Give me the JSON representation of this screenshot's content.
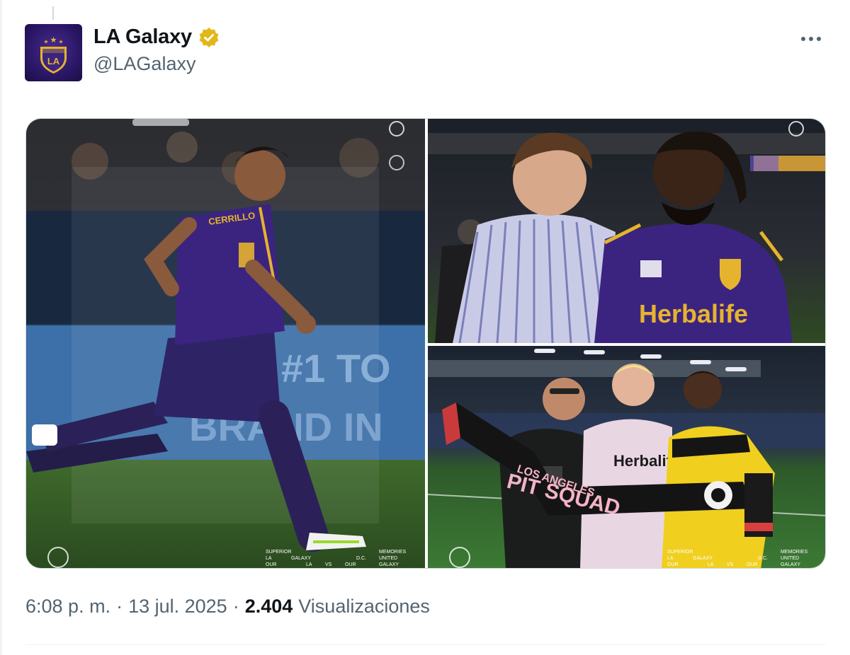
{
  "tweet": {
    "author": {
      "display_name": "LA Galaxy",
      "handle": "@LAGalaxy",
      "verified": true,
      "avatar_icon": "la-galaxy-crest-icon",
      "avatar_text": "LA"
    },
    "more_icon": "more-horizontal-icon",
    "media": [
      {
        "id": "photo-1",
        "jersey_text": "CERRILLO",
        "board_text": "#1 TO",
        "board_text_2": "BRAND IN",
        "corner_text": [
          "SUPERIOR",
          "LA",
          "GALAXY",
          "VS",
          "D.C.",
          "MEMORIES",
          "OUR",
          "LA",
          "OUR",
          "UNITED",
          "GALAXY"
        ]
      },
      {
        "id": "photo-2",
        "jersey_sponsor": "Herbalife"
      },
      {
        "id": "photo-3",
        "jersey_sponsor": "Herbalife",
        "scarf_text": "LOS ANGELES",
        "scarf_text_2": "PIT SQUAD",
        "corner_text": [
          "SUPERIOR",
          "LA",
          "GALAXY",
          "VS",
          "D.C.",
          "MEMORIES",
          "OUR",
          "LA",
          "OUR",
          "UNITED",
          "GALAXY"
        ]
      }
    ],
    "meta": {
      "time": "6:08 p. m.",
      "date": "13 jul. 2025",
      "separator": "·",
      "views_count": "2.404",
      "views_label": "Visualizaciones"
    },
    "colors": {
      "verified_badge": "#e2b719",
      "galaxy_purple": "#3b2480",
      "galaxy_gold": "#e6b32e",
      "text_primary": "#0f1419",
      "text_secondary": "#536471"
    }
  }
}
